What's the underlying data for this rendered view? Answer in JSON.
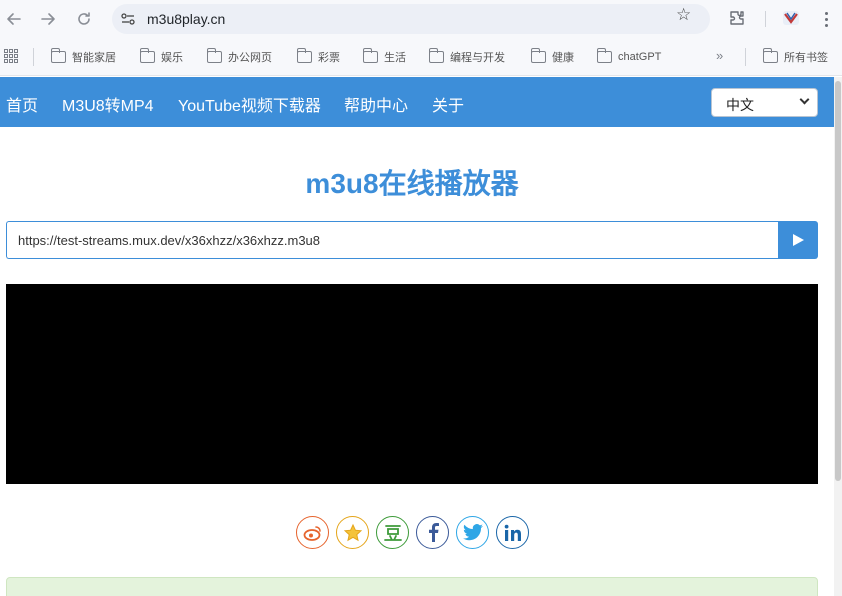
{
  "browser": {
    "url": "m3u8play.cn",
    "nav_icons": [
      "back-icon",
      "forward-icon",
      "reload-icon",
      "site-info-icon",
      "bookmark-star-icon",
      "extensions-icon",
      "profile-icon",
      "menu-icon"
    ],
    "bookmarks": [
      "智能家居",
      "娱乐",
      "办公网页",
      "彩票",
      "生活",
      "编程与开发",
      "健康",
      "chatGPT"
    ],
    "overflow": "»",
    "all_bookmarks": "所有书签"
  },
  "site": {
    "nav": [
      "首页",
      "M3U8转MP4",
      "YouTube视频下载器",
      "帮助中心",
      "关于"
    ],
    "language": "中文",
    "title": "m3u8在线播放器",
    "input_value": "https://test-streams.mux.dev/x36xhzz/x36xhzz.m3u8",
    "share": [
      {
        "name": "weibo",
        "label": "微",
        "color": "#e6642d"
      },
      {
        "name": "qzone",
        "label": "★",
        "color": "#e5a51a"
      },
      {
        "name": "douban",
        "label": "豆",
        "color": "#3e9b3a"
      },
      {
        "name": "facebook",
        "label": "f",
        "color": "#3b5a99"
      },
      {
        "name": "twitter",
        "label": "t",
        "color": "#2ea6e6"
      },
      {
        "name": "linkedin",
        "label": "in",
        "color": "#1a66a8"
      }
    ],
    "colors": {
      "brand": "#3d8ed9",
      "notice_bg": "#e4f3dc"
    }
  }
}
